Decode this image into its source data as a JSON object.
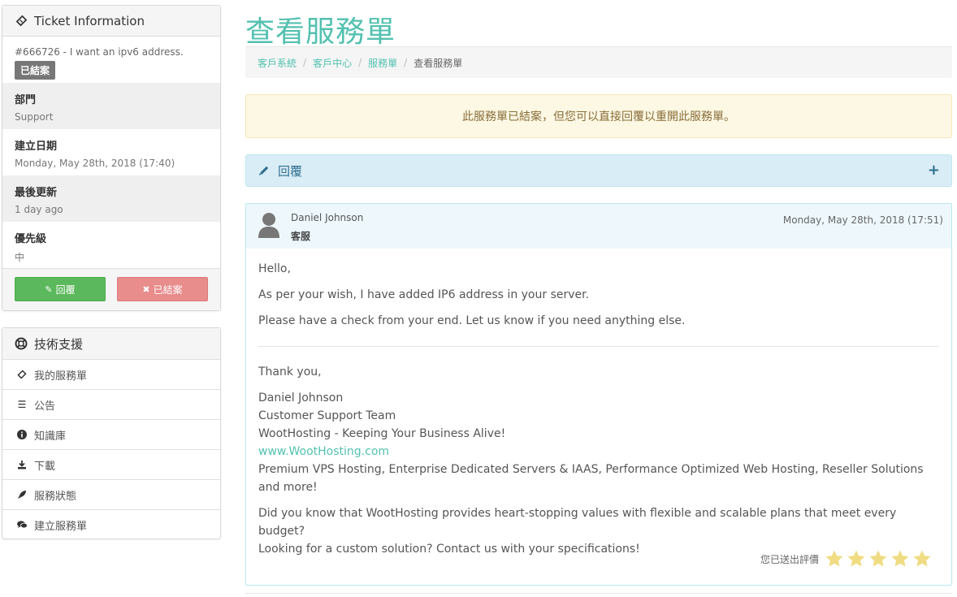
{
  "sidebar": {
    "ticket_panel": {
      "title": "Ticket Information",
      "ticket_line": "#666726 - I want an ipv6 address.",
      "status_badge": "已結案",
      "department_label": "部門",
      "department_value": "Support",
      "created_label": "建立日期",
      "created_value": "Monday, May 28th, 2018 (17:40)",
      "updated_label": "最後更新",
      "updated_value": "1 day ago",
      "priority_label": "優先級",
      "priority_value": "中",
      "reply_button": "回覆",
      "closed_button": "已結案"
    },
    "support_panel": {
      "title": "技術支援",
      "items": [
        {
          "label": "我的服務單",
          "icon": "ticket-icon"
        },
        {
          "label": "公告",
          "icon": "list-icon"
        },
        {
          "label": "知識庫",
          "icon": "info-icon"
        },
        {
          "label": "下載",
          "icon": "download-icon"
        },
        {
          "label": "服務狀態",
          "icon": "rocket-icon"
        },
        {
          "label": "建立服務單",
          "icon": "comments-icon"
        }
      ]
    }
  },
  "main": {
    "page_title": "查看服務單",
    "breadcrumb": [
      "客戶系統",
      "客戶中心",
      "服務單",
      "查看服務單"
    ],
    "alert_text": "此服務單已結案，但您可以直接回覆以重開此服務單。",
    "reply_bar_label": "回覆",
    "message": {
      "author": "Daniel Johnson",
      "role": "客服",
      "date": "Monday, May 28th, 2018 (17:51)",
      "greeting": "Hello,",
      "line1": "As per your wish, I have added IP6 address in your server.",
      "line2": "Please have a check from your end. Let us know if you need anything else.",
      "thanks": "Thank you,",
      "sig_name": "Daniel Johnson",
      "sig_team": "Customer Support Team",
      "sig_tagline": "WootHosting - Keeping Your Business Alive!",
      "sig_link": "www.WootHosting.com",
      "sig_services": "Premium VPS Hosting, Enterprise Dedicated Servers & IAAS, Performance Optimized Web Hosting, Reseller Solutions and more!",
      "promo1": "Did you know that WootHosting provides heart-stopping values with flexible and scalable plans that meet every budget?",
      "promo2": "Looking for a custom solution? Contact us with your specifications!",
      "rating_text": "您已送出評價",
      "rating_stars": 5,
      "rating_max": 5
    }
  },
  "colors": {
    "accent": "#53c1b0",
    "alert_bg": "#fcf8e3",
    "reply_bg": "#d9edf7",
    "success": "#5cb85c",
    "danger_light": "#e88c8c",
    "star": "#f0dc82"
  }
}
